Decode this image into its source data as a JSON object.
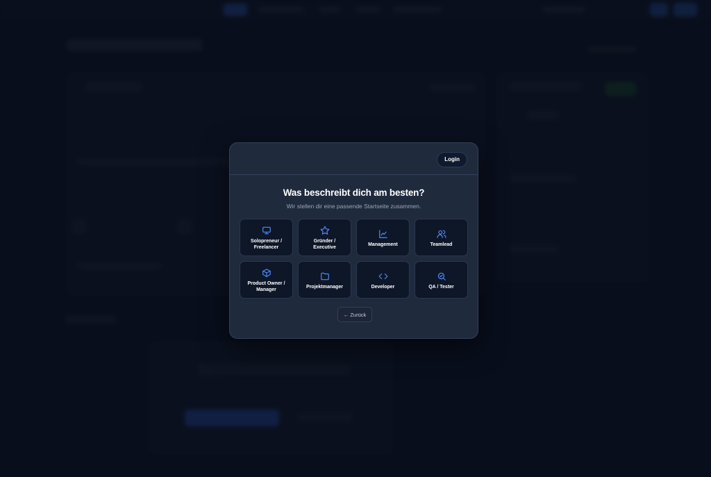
{
  "modal": {
    "login_label": "Login",
    "title": "Was beschreibt dich am besten?",
    "subtitle": "Wir stellen dir eine passende Startseite zusammen.",
    "back_label": "← Zurück",
    "roles": [
      {
        "label_lines": [
          "Solopreneur /",
          "Freelancer"
        ],
        "icon": "monitor-icon"
      },
      {
        "label_lines": [
          "Gründer /",
          "Executive"
        ],
        "icon": "star-icon"
      },
      {
        "label_lines": [
          "Management"
        ],
        "icon": "chart-icon"
      },
      {
        "label_lines": [
          "Teamlead"
        ],
        "icon": "users-icon"
      },
      {
        "label_lines": [
          "Product Owner /",
          "Manager"
        ],
        "icon": "package-icon"
      },
      {
        "label_lines": [
          "Projektmanager"
        ],
        "icon": "folder-icon"
      },
      {
        "label_lines": [
          "Developer"
        ],
        "icon": "code-icon"
      },
      {
        "label_lines": [
          "QA / Tester"
        ],
        "icon": "search-check-icon"
      }
    ]
  },
  "colors": {
    "accent": "#4f8bff",
    "modal_bg": "#1f2a3d",
    "tile_bg": "#0d1728",
    "page_bg": "#0d1526"
  }
}
